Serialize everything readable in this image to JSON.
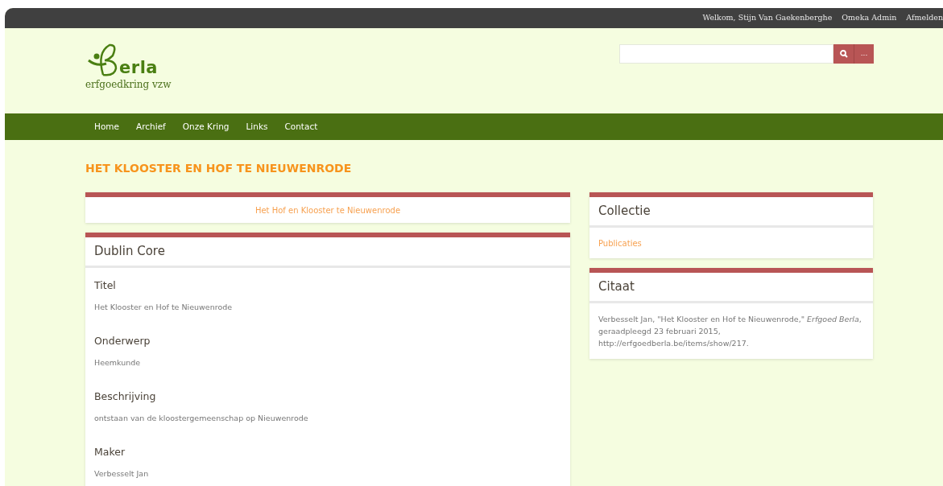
{
  "topbar": {
    "links": [
      "Welkom, Stijn Van Gaekenberghe",
      "Omeka Admin",
      "Afmelden"
    ]
  },
  "logo": {
    "wordmark": "erla",
    "tagline": "erfgoedkring vzw"
  },
  "search": {
    "more_label": "..."
  },
  "nav": {
    "items": [
      "Home",
      "Archief",
      "Onze Kring",
      "Links",
      "Contact"
    ]
  },
  "page_title": "HET KLOOSTER EN HOF TE NIEUWENRODE",
  "file_link": "Het Hof en Klooster te Nieuwenrode",
  "dublin_core": {
    "title": "Dublin Core",
    "fields": [
      {
        "label": "Titel",
        "value": "Het Klooster en Hof te Nieuwenrode"
      },
      {
        "label": "Onderwerp",
        "value": "Heemkunde"
      },
      {
        "label": "Beschrijving",
        "value": "ontstaan van de kloostergemeenschap op Nieuwenrode"
      },
      {
        "label": "Maker",
        "value": "Verbesselt Jan"
      }
    ]
  },
  "collection": {
    "title": "Collectie",
    "link": "Publicaties"
  },
  "citation": {
    "title": "Citaat",
    "text": "Verbesselt Jan, \"Het Klooster en Hof te Nieuwenrode,\" *Erfgoed Berla*, geraadpleegd 23 februari 2015, http://erfgoedberla.be/items/show/217."
  }
}
